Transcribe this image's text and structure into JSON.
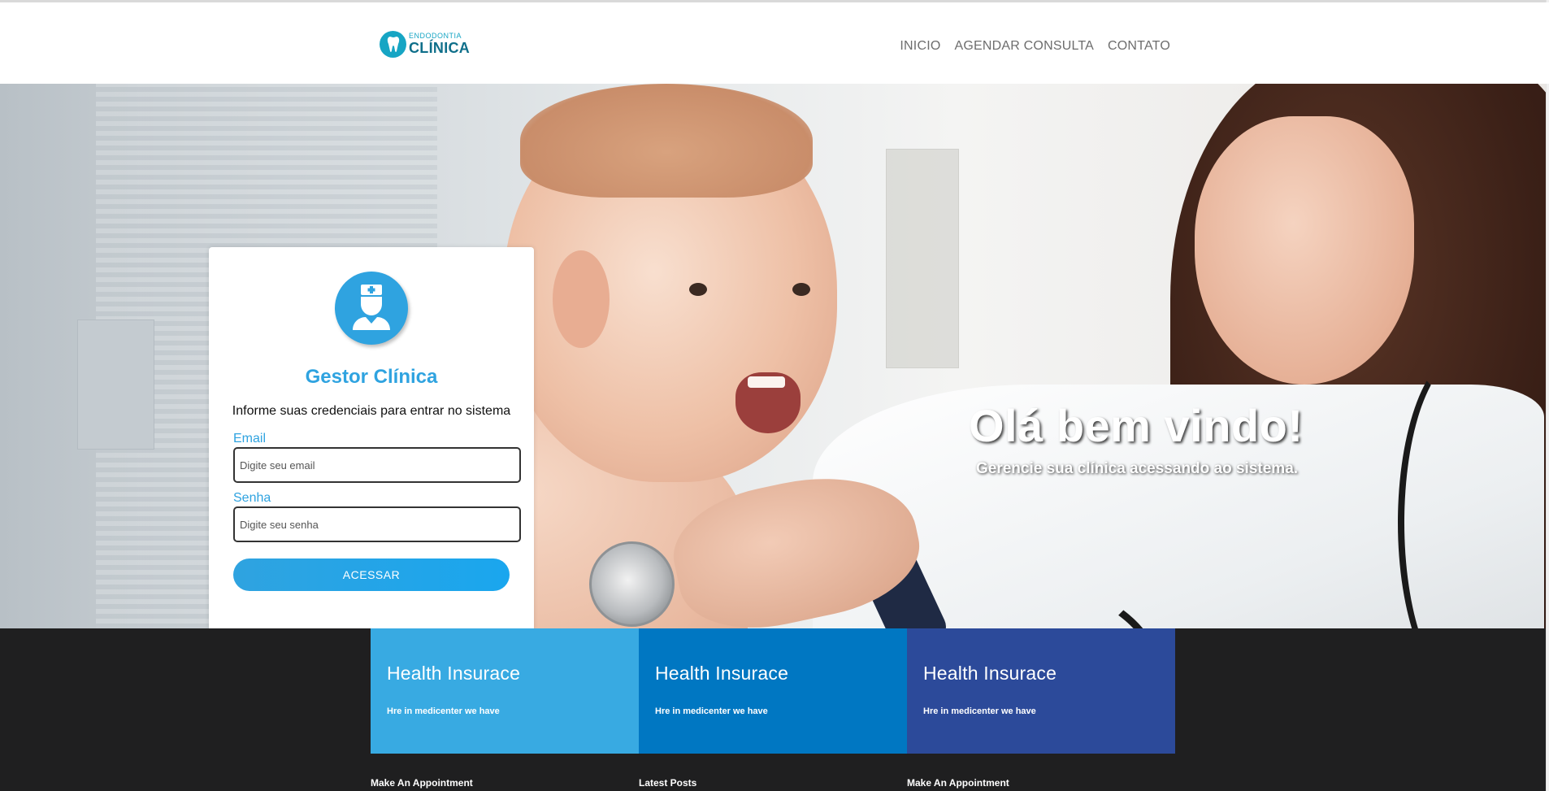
{
  "logo": {
    "small": "ENDODONTIA",
    "big": "CLÍNICA"
  },
  "nav": {
    "items": [
      "INICIO",
      "AGENDAR CONSULTA",
      "CONTATO"
    ]
  },
  "hero": {
    "title": "Olá bem vindo!",
    "subtitle": "Gerencie sua clínica acessando ao sistema."
  },
  "login": {
    "title": "Gestor Clínica",
    "subtitle": "Informe suas credenciais para entrar no sistema",
    "email_label": "Email",
    "email_placeholder": "Digite seu email",
    "password_label": "Senha",
    "password_placeholder": "Digite seu senha",
    "button": "ACESSAR"
  },
  "info_boxes": [
    {
      "title": "Health Insurace",
      "text": "Hre in medicenter we have",
      "color": "#38aae2"
    },
    {
      "title": "Health Insurace",
      "text": "Hre in medicenter we have",
      "color": "#0077c2"
    },
    {
      "title": "Health Insurace",
      "text": "Hre in medicenter we have",
      "color": "#2c4a9a"
    }
  ],
  "footer": {
    "headings": [
      "Make An Appointment",
      "Latest Posts",
      "Make An Appointment"
    ]
  },
  "colors": {
    "accent": "#2fa3e0",
    "logo_teal": "#16a5c4",
    "footer_bg": "#1f1f20"
  }
}
